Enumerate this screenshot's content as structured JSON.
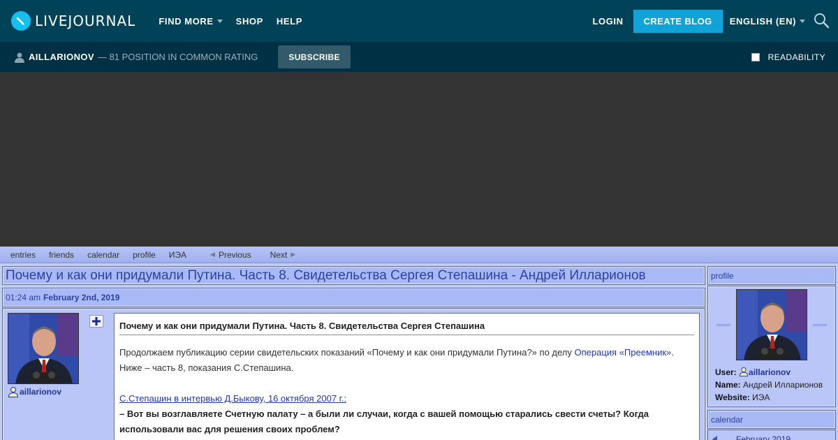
{
  "header": {
    "logo_text": "LIVEJOURNAL",
    "nav": [
      {
        "label": "FIND MORE",
        "has_dropdown": true
      },
      {
        "label": "SHOP",
        "has_dropdown": false
      },
      {
        "label": "HELP",
        "has_dropdown": false
      }
    ],
    "login_label": "LOGIN",
    "create_blog_label": "CREATE BLOG",
    "language_label": "ENGLISH (EN)",
    "accent_color": "#0fa3d8",
    "bar_color": "#004359"
  },
  "subbar": {
    "journal_name": "AILLARIONOV",
    "rating_text": "— 81 POSITION IN COMMON RATING",
    "subscribe_label": "SUBSCRIBE",
    "readability_label": "READABILITY",
    "readability_checked": false
  },
  "journal_nav": {
    "items": [
      "entries",
      "friends",
      "calendar",
      "profile",
      "ИЭА"
    ],
    "previous_label": "Previous",
    "next_label": "Next"
  },
  "page_title": "Почему и как они придумали Путина. Часть 8. Свидетельства Сергея Степашина - Андрей Илларионов",
  "entry": {
    "time": "01:24 am",
    "date": "February 2nd, 2019",
    "username": "aillarionov",
    "subject": "Почему и как они придумали Путина. Часть 8. Свидетельства Сергея Степашина",
    "para1_before": "Продолжаем публикацию серии свидетельских показаний «Почему и как они придумали Путина?» по делу ",
    "para1_link": "Операция «Преемник»",
    "para1_after": ".",
    "para2": "Ниже – часть 8, показания С.Степашина.",
    "source_link": "С.Степашин в интервью Д.Быкову, 16 октября 2007 г.:",
    "question": "– Вот вы возглавляете Счетную палату – а были ли случаи, когда с вашей помощью старались свести счеты? Когда использовали вас для решения своих проблем?"
  },
  "sidebar": {
    "profile_heading": "profile",
    "user_label": "User:",
    "user_value": "aillarionov",
    "name_label": "Name:",
    "name_value": "Андрей Илларионов",
    "website_label": "Website:",
    "website_value": "ИЭА",
    "calendar_heading": "calendar",
    "calendar_month": "February 2019"
  }
}
